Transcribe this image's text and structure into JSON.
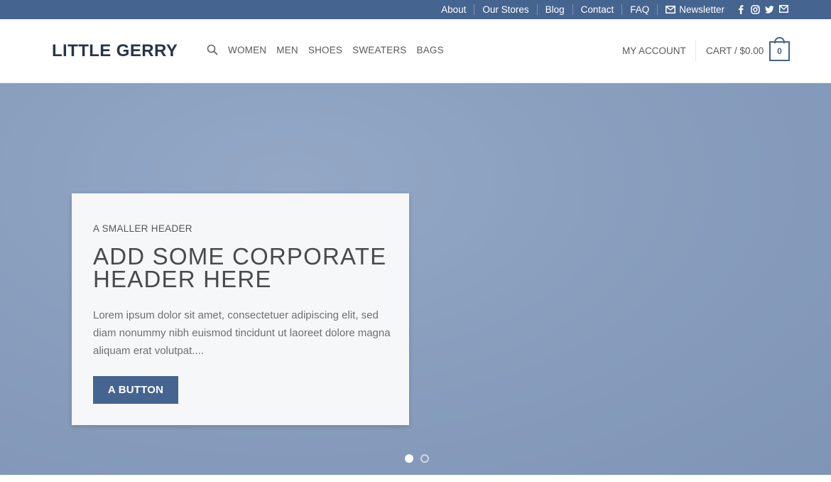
{
  "topbar": {
    "links": [
      "About",
      "Our Stores",
      "Blog",
      "Contact",
      "FAQ"
    ],
    "newsletter": "Newsletter",
    "social_icons": [
      "facebook-icon",
      "instagram-icon",
      "twitter-icon",
      "email-icon"
    ]
  },
  "header": {
    "logo": "LITTLE GERRY",
    "nav": [
      "WOMEN",
      "MEN",
      "SHOES",
      "SWEATERS",
      "BAGS"
    ],
    "account": "MY ACCOUNT",
    "cart": "CART / $0.00",
    "cart_count": "0"
  },
  "hero": {
    "small_header": "A SMALLER HEADER",
    "big_header": "ADD SOME CORPORATE HEADER HERE",
    "body": "Lorem ipsum dolor sit amet, consectetuer adipiscing elit, sed diam nonummy nibh euismod tincidunt ut laoreet dolore magna aliquam erat volutpat....",
    "button": "A BUTTON",
    "slides": 2,
    "active_slide": 1
  },
  "colors": {
    "brand": "#45648f",
    "logo": "#27344c",
    "hero_bg": "#8a9fbe"
  }
}
